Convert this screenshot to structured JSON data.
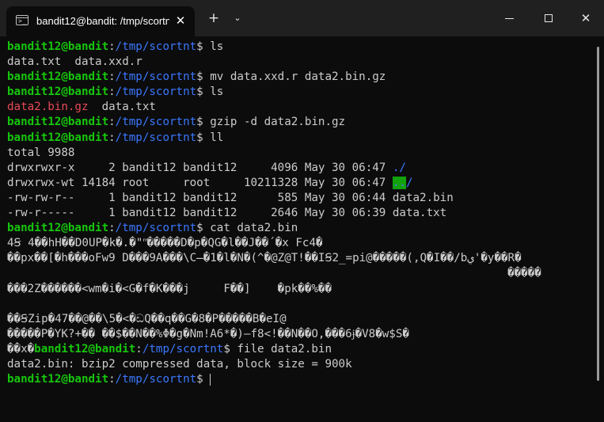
{
  "window": {
    "tab_title": "bandit12@bandit: /tmp/scortnt",
    "tab_icon_text": ">_",
    "close_tab": "✕",
    "new_tab": "+",
    "dropdown": "⌄",
    "close": "✕"
  },
  "terminal": {
    "user": "bandit12@bandit",
    "sep": ":",
    "path": "/tmp/scortnt",
    "prompt_end": "$ ",
    "lines": [
      {
        "cmd": "ls"
      },
      {
        "out": "data.txt  data.xxd.r"
      },
      {
        "cmd": "mv data.xxd.r data2.bin.gz"
      },
      {
        "cmd": "ls"
      },
      {
        "red": "data2.bin.gz",
        "out": "  data.txt"
      },
      {
        "cmd": "gzip -d data2.bin.gz"
      },
      {
        "cmd": "ll"
      },
      {
        "out": "total 9988"
      },
      {
        "out": "drwxrwxr-x     2 bandit12 bandit12     4096 May 30 06:47 ",
        "blue": "./"
      },
      {
        "out": "drwxrwx-wt 14184 root     root     10211328 May 30 06:47 ",
        "hl": "..",
        "blue": "/"
      },
      {
        "out": "-rw-rw-r--     1 bandit12 bandit12      585 May 30 06:44 data2.bin"
      },
      {
        "out": "-rw-r-----     1 bandit12 bandit12     2646 May 30 06:39 data.txt"
      },
      {
        "cmd": "cat data2.bin"
      },
      {
        "out": "4Ꞩ 4��hH��D0UP�k�.�\"ʺ�����D�p�QG�l��J��´�x Fc4�"
      },
      {
        "out": "��px��[�h���oFw9 D���9A���\\C̶�1�l�N�(^�@Z@T!��IꞨ2_=pi@�����(,Q�I��/bي'�y��R�"
      },
      {
        "out": "                                                                          �����"
      },
      {
        "out": "���2Z������<wm�i�<G�f�K���j     F��]    �pk��%��"
      },
      {
        "out": ""
      },
      {
        "out": "��ꞨZip�47��@��\\5�<�ඩQ��q��G�8�P�����B�eI@"
      },
      {
        "out": "�����P�YK?+�� ��$��N��%Φ�g�Nm!A6*�)—f8<!��N��O,���6ɉ�V8�w$S�"
      },
      {
        "junk": "��x�",
        "cmd": "file data2.bin"
      },
      {
        "out": "data2.bin: bzip2 compressed data, block size = 900k"
      },
      {
        "cmd": "",
        "cursor": true
      }
    ]
  },
  "colors": {
    "background": "#0c0c0c",
    "prompt_user": "#16c60c",
    "prompt_path": "#3b78ff",
    "text": "#cccccc",
    "archive": "#e74856"
  }
}
